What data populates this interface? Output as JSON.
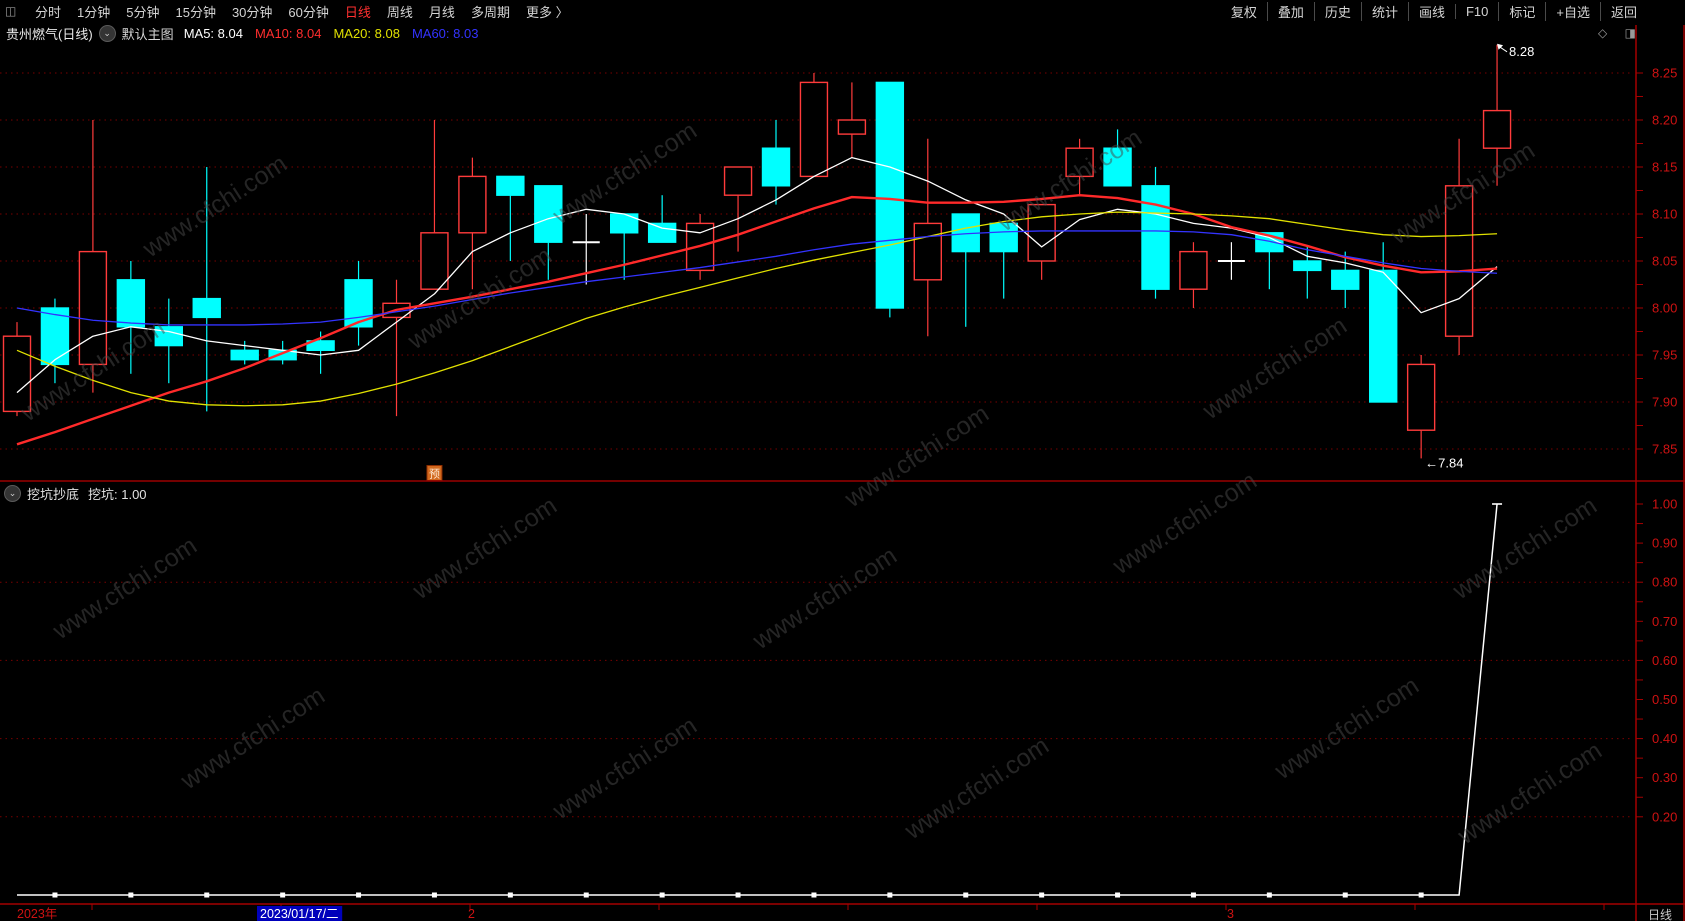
{
  "toolbar": {
    "left_icon": "◫",
    "items_left": [
      "分时",
      "1分钟",
      "5分钟",
      "15分钟",
      "30分钟",
      "60分钟",
      "日线",
      "周线",
      "月线",
      "多周期",
      "更多 〉"
    ],
    "active_item": "日线",
    "items_right": [
      "复权",
      "叠加",
      "历史",
      "统计",
      "画线",
      "F10",
      "标记",
      "+自选",
      "返回"
    ]
  },
  "legend": {
    "title": "贵州燃气(日线)",
    "chevron_icon": "⌄",
    "main_chart_label": "默认主图",
    "ma": [
      {
        "label": "MA5: 8.04",
        "color": "#ffffff"
      },
      {
        "label": "MA10: 8.04",
        "color": "#ff2e2e"
      },
      {
        "label": "MA20: 8.08",
        "color": "#e1e100"
      },
      {
        "label": "MA60: 8.03",
        "color": "#3333ff"
      }
    ],
    "right_icons": "◇ ◨"
  },
  "sub_pane": {
    "collapse_icon": "⌄",
    "title": "挖坑抄底",
    "value_label": "挖坑: 1.00"
  },
  "period_label": "日线",
  "watermark_text": "www.cfchi.com",
  "colors": {
    "up": "#ff3b3b",
    "down": "#00ffff",
    "doji": "#ffffff",
    "ma5": "#ffffff",
    "ma10": "#ff2a2a",
    "ma20": "#e1e100",
    "ma60": "#3333ff",
    "grid": "#780000",
    "axis_line": "#a40000",
    "axis_text": "#cf1212",
    "signal_bg": "#d2691e",
    "date_highlight_bg": "#0000bb",
    "indicator_line": "#ffffff"
  },
  "chart_data": {
    "type": "candlestick",
    "panes": [
      {
        "name": "main-price-pane",
        "axis_labels": [
          "8.25",
          "8.20",
          "8.15",
          "8.10",
          "8.05",
          "8.00",
          "7.95",
          "7.90",
          "7.85"
        ],
        "axis_values": [
          8.25,
          8.2,
          8.15,
          8.1,
          8.05,
          8.0,
          7.95,
          7.9,
          7.85
        ],
        "candles_ohlc": [
          [
            7.89,
            7.985,
            7.885,
            7.97
          ],
          [
            8.0,
            8.01,
            7.92,
            7.94
          ],
          [
            7.94,
            8.2,
            7.91,
            8.06
          ],
          [
            8.03,
            8.05,
            7.93,
            7.98
          ],
          [
            7.98,
            8.01,
            7.92,
            7.96
          ],
          [
            8.01,
            8.15,
            7.89,
            7.99
          ],
          [
            7.955,
            7.965,
            7.94,
            7.945
          ],
          [
            7.955,
            7.965,
            7.94,
            7.945
          ],
          [
            7.965,
            7.975,
            7.93,
            7.955
          ],
          [
            8.03,
            8.05,
            7.96,
            7.98
          ],
          [
            7.99,
            8.03,
            7.885,
            8.005
          ],
          [
            8.02,
            8.2,
            8.02,
            8.08
          ],
          [
            8.08,
            8.16,
            8.02,
            8.14
          ],
          [
            8.14,
            8.14,
            8.05,
            8.12
          ],
          [
            8.13,
            8.13,
            8.03,
            8.07
          ],
          [
            8.07,
            8.1,
            8.025,
            8.07
          ],
          [
            8.1,
            8.1,
            8.03,
            8.08
          ],
          [
            8.09,
            8.12,
            8.07,
            8.07
          ],
          [
            8.04,
            8.1,
            8.03,
            8.09
          ],
          [
            8.12,
            8.15,
            8.06,
            8.15
          ],
          [
            8.17,
            8.2,
            8.11,
            8.13
          ],
          [
            8.14,
            8.25,
            8.14,
            8.24
          ],
          [
            8.185,
            8.24,
            8.16,
            8.2
          ],
          [
            8.24,
            8.24,
            7.99,
            8.0
          ],
          [
            8.03,
            8.18,
            7.97,
            8.09
          ],
          [
            8.1,
            8.1,
            7.98,
            8.06
          ],
          [
            8.09,
            8.09,
            8.01,
            8.06
          ],
          [
            8.05,
            8.11,
            8.03,
            8.11
          ],
          [
            8.14,
            8.18,
            8.12,
            8.17
          ],
          [
            8.17,
            8.19,
            8.13,
            8.13
          ],
          [
            8.13,
            8.15,
            8.01,
            8.02
          ],
          [
            8.02,
            8.07,
            8.0,
            8.06
          ],
          [
            8.05,
            8.07,
            8.03,
            8.05
          ],
          [
            8.08,
            8.08,
            8.02,
            8.06
          ],
          [
            8.05,
            8.065,
            8.01,
            8.04
          ],
          [
            8.04,
            8.06,
            8.0,
            8.02
          ],
          [
            8.04,
            8.07,
            7.9,
            7.9
          ],
          [
            7.87,
            7.95,
            7.84,
            7.94
          ],
          [
            7.97,
            8.18,
            7.95,
            8.13
          ],
          [
            8.17,
            8.28,
            8.13,
            8.21
          ]
        ],
        "ma_series": [
          {
            "name": "MA5",
            "color_key": "ma5",
            "values": [
              7.91,
              7.945,
              7.97,
              7.98,
              7.975,
              7.965,
              7.96,
              7.955,
              7.95,
              7.955,
              7.985,
              8.015,
              8.06,
              8.08,
              8.095,
              8.105,
              8.1,
              8.085,
              8.08,
              8.095,
              8.115,
              8.14,
              8.16,
              8.15,
              8.135,
              8.115,
              8.1,
              8.065,
              8.094,
              8.105,
              8.1,
              8.09,
              8.085,
              8.075,
              8.055,
              8.048,
              8.038,
              7.995,
              8.01,
              8.044
            ]
          },
          {
            "name": "MA10",
            "color_key": "ma10",
            "values": [
              7.855,
              7.868,
              7.882,
              7.896,
              7.91,
              7.922,
              7.936,
              7.952,
              7.968,
              7.985,
              7.998,
              8.005,
              8.012,
              8.02,
              8.028,
              8.037,
              8.046,
              8.056,
              8.066,
              8.078,
              8.092,
              8.106,
              8.118,
              8.116,
              8.112,
              8.112,
              8.113,
              8.116,
              8.12,
              8.117,
              8.11,
              8.1,
              8.086,
              8.077,
              8.066,
              8.054,
              8.045,
              8.038,
              8.039,
              8.042
            ]
          },
          {
            "name": "MA20",
            "color_key": "ma20",
            "values": [
              7.955,
              7.938,
              7.923,
              7.91,
              7.901,
              7.897,
              7.896,
              7.897,
              7.901,
              7.909,
              7.919,
              7.931,
              7.944,
              7.959,
              7.974,
              7.989,
              8.001,
              8.012,
              8.022,
              8.032,
              8.042,
              8.051,
              8.059,
              8.067,
              8.076,
              8.085,
              8.092,
              8.097,
              8.1,
              8.102,
              8.101,
              8.1,
              8.098,
              8.095,
              8.089,
              8.083,
              8.078,
              8.076,
              8.077,
              8.079
            ]
          },
          {
            "name": "MA60",
            "color_key": "ma60",
            "values": [
              8.0,
              7.993,
              7.987,
              7.984,
              7.982,
              7.982,
              7.982,
              7.983,
              7.985,
              7.99,
              7.996,
              8.002,
              8.009,
              8.016,
              8.022,
              8.028,
              8.033,
              8.038,
              8.043,
              8.049,
              8.055,
              8.062,
              8.068,
              8.072,
              8.076,
              8.079,
              8.081,
              8.082,
              8.082,
              8.082,
              8.082,
              8.081,
              8.078,
              8.071,
              8.062,
              8.055,
              8.048,
              8.042,
              8.039,
              8.037
            ]
          }
        ],
        "annotations": [
          {
            "type": "high",
            "text": "8.28",
            "candle_index": 39
          },
          {
            "type": "low",
            "text": "←7.84",
            "candle_index": 37
          },
          {
            "type": "signal_marker",
            "text": "预",
            "candle_index": 11
          }
        ]
      },
      {
        "name": "indicator-pane",
        "title": "挖坑抄底",
        "axis_labels": [
          "1.00",
          "0.90",
          "0.80",
          "0.70",
          "0.60",
          "0.50",
          "0.40",
          "0.30",
          "0.20"
        ],
        "axis_values": [
          1.0,
          0.9,
          0.8,
          0.7,
          0.6,
          0.5,
          0.4,
          0.3,
          0.2
        ],
        "dotted_levels": [
          0.8,
          0.6,
          0.4,
          0.2
        ],
        "series": [
          {
            "name": "挖坑",
            "last_value": 1.0,
            "values": [
              0,
              0,
              0,
              0,
              0,
              0,
              0,
              0,
              0,
              0,
              0,
              0,
              0,
              0,
              0,
              0,
              0,
              0,
              0,
              0,
              0,
              0,
              0,
              0,
              0,
              0,
              0,
              0,
              0,
              0,
              0,
              0,
              0,
              0,
              0,
              0,
              0,
              0,
              0,
              1.0
            ]
          }
        ]
      }
    ],
    "x_axis": {
      "labels": [
        {
          "text": "2023年",
          "x": 17,
          "highlight": false
        },
        {
          "text": "2023/01/17/二",
          "x": 260,
          "highlight": true
        },
        {
          "text": "2",
          "x": 468,
          "highlight": false
        },
        {
          "text": "3",
          "x": 1227,
          "highlight": false
        }
      ],
      "tick_xs": [
        92,
        281,
        470,
        659,
        848,
        1037,
        1226,
        1415,
        1604
      ]
    }
  }
}
